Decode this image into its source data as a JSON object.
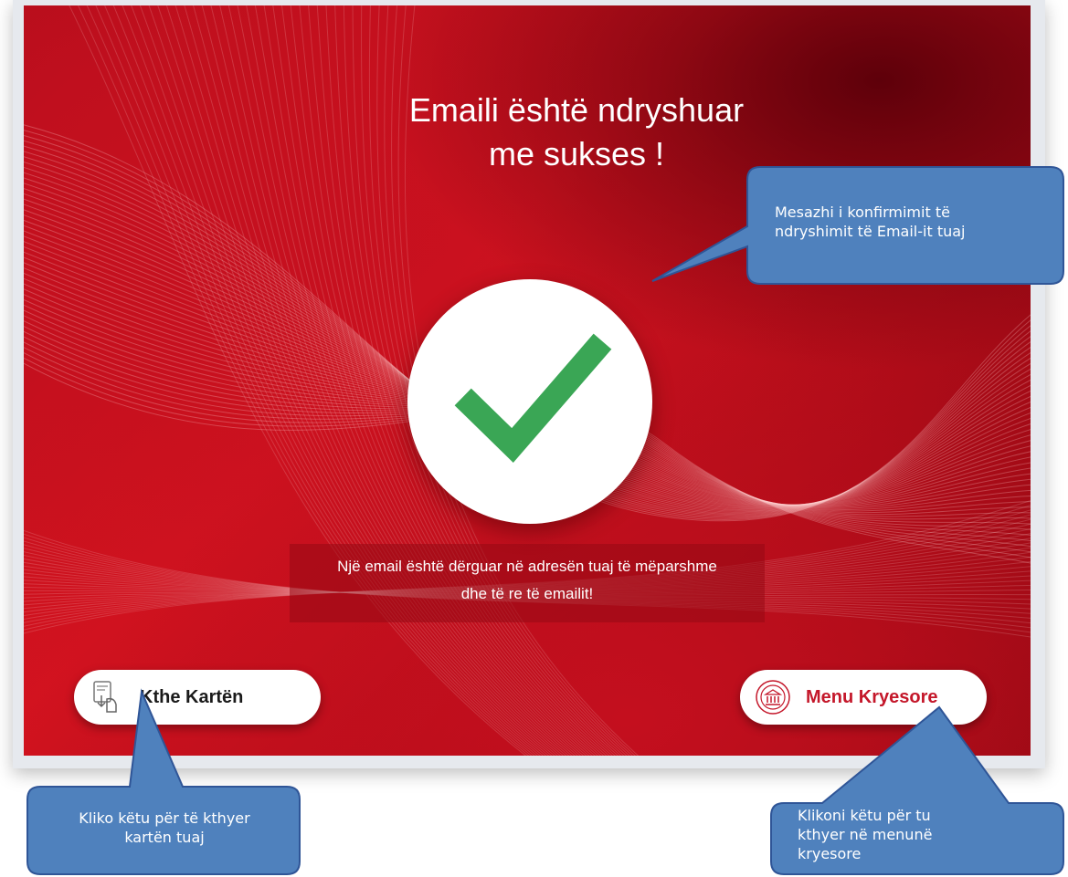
{
  "screen": {
    "title_line1": "Emaili është ndryshuar",
    "title_line2": "me sukses !",
    "status_icon": "checkmark-icon",
    "message_line1": "Një email është dërguar në adresën tuaj të mëparshme",
    "message_line2": "dhe të re të emailit!"
  },
  "buttons": {
    "return_card": {
      "label": "Kthe Kartën",
      "icon": "card-return-icon"
    },
    "main_menu": {
      "label": "Menu Kryesore",
      "icon": "bank-icon"
    }
  },
  "callouts": {
    "confirmation": {
      "line1": "Mesazhi i konfirmimit të",
      "line2": "ndryshimit të Email-it tuaj"
    },
    "return_card": {
      "line1": "Kliko këtu për të kthyer",
      "line2": "kartën tuaj"
    },
    "main_menu": {
      "line1": "Klikoni këtu për tu",
      "line2": "kthyer në menunë",
      "line3": "kryesore"
    }
  },
  "colors": {
    "background_red": "#c8101f",
    "check_green": "#3aa655",
    "menu_label_red": "#c4172a",
    "callout_blue": "#4f81bd"
  }
}
